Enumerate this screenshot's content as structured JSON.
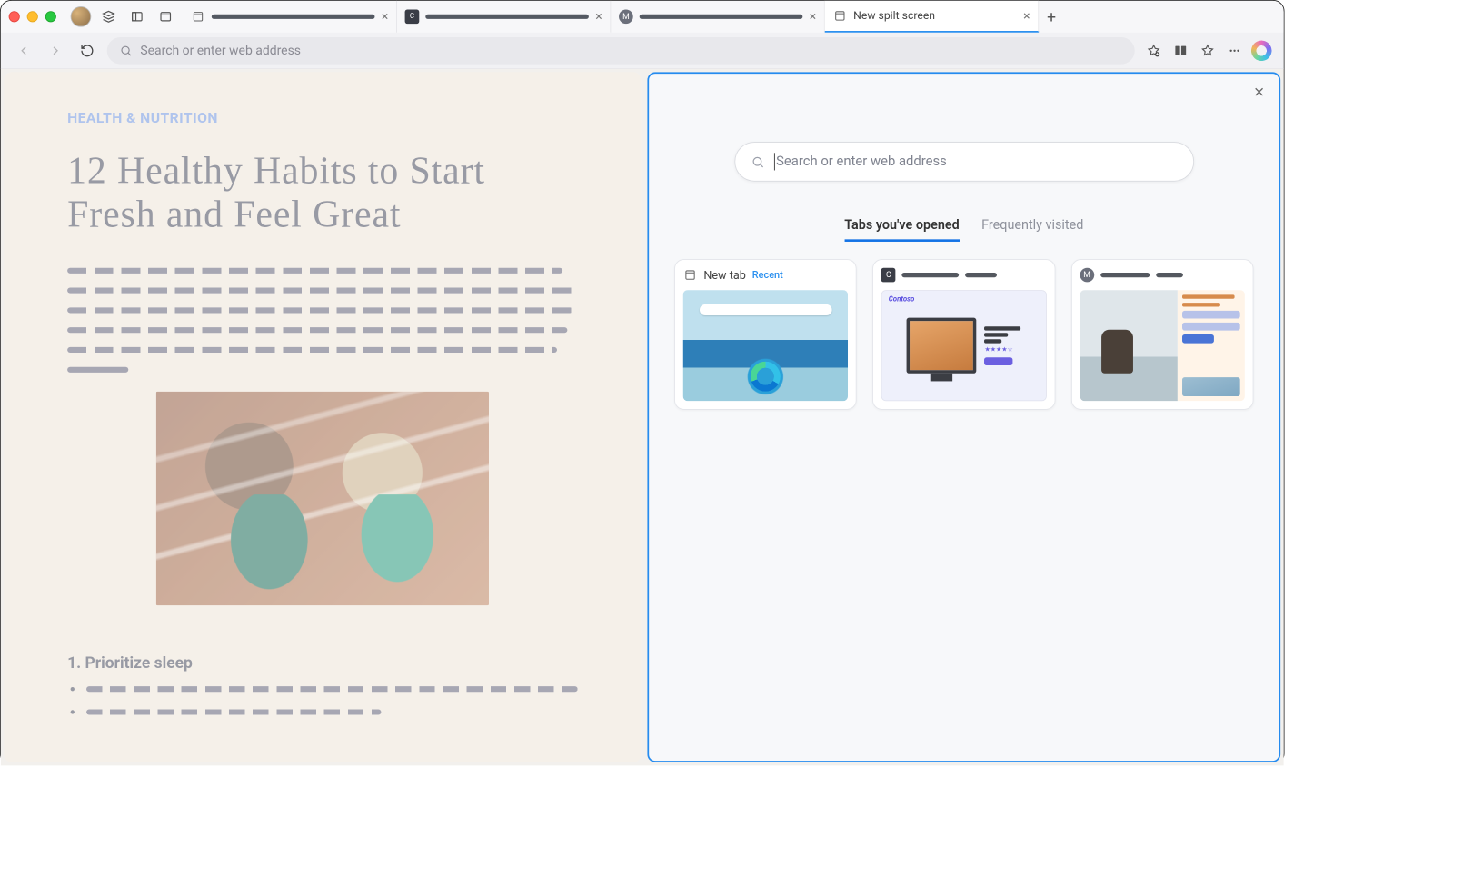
{
  "chrome": {
    "tabs": [
      {
        "favicon": "page",
        "redacted": true
      },
      {
        "favicon": "box",
        "favicon_text": "C",
        "redacted": true
      },
      {
        "favicon": "circle",
        "favicon_text": "M",
        "redacted": true
      },
      {
        "favicon": "page",
        "title": "New spilt screen",
        "redacted": false,
        "active": true
      }
    ],
    "address_placeholder": "Search or enter web address"
  },
  "left_article": {
    "category": "HEALTH & NUTRITION",
    "title": "12 Healthy Habits to Start Fresh and Feel Great",
    "section_heading": "1. Prioritize sleep"
  },
  "split": {
    "search_placeholder": "Search or enter web address",
    "tabs": {
      "opened": "Tabs you've opened",
      "frequent": "Frequently visited"
    },
    "cards": [
      {
        "favicon": "page",
        "title": "New tab",
        "badge": "Recent",
        "thumb": "edge"
      },
      {
        "favicon": "box",
        "favicon_text": "C",
        "redacted": true,
        "thumb": "product",
        "brand": "Contoso"
      },
      {
        "favicon": "circle",
        "favicon_text": "M",
        "redacted": true,
        "thumb": "travel"
      }
    ]
  }
}
